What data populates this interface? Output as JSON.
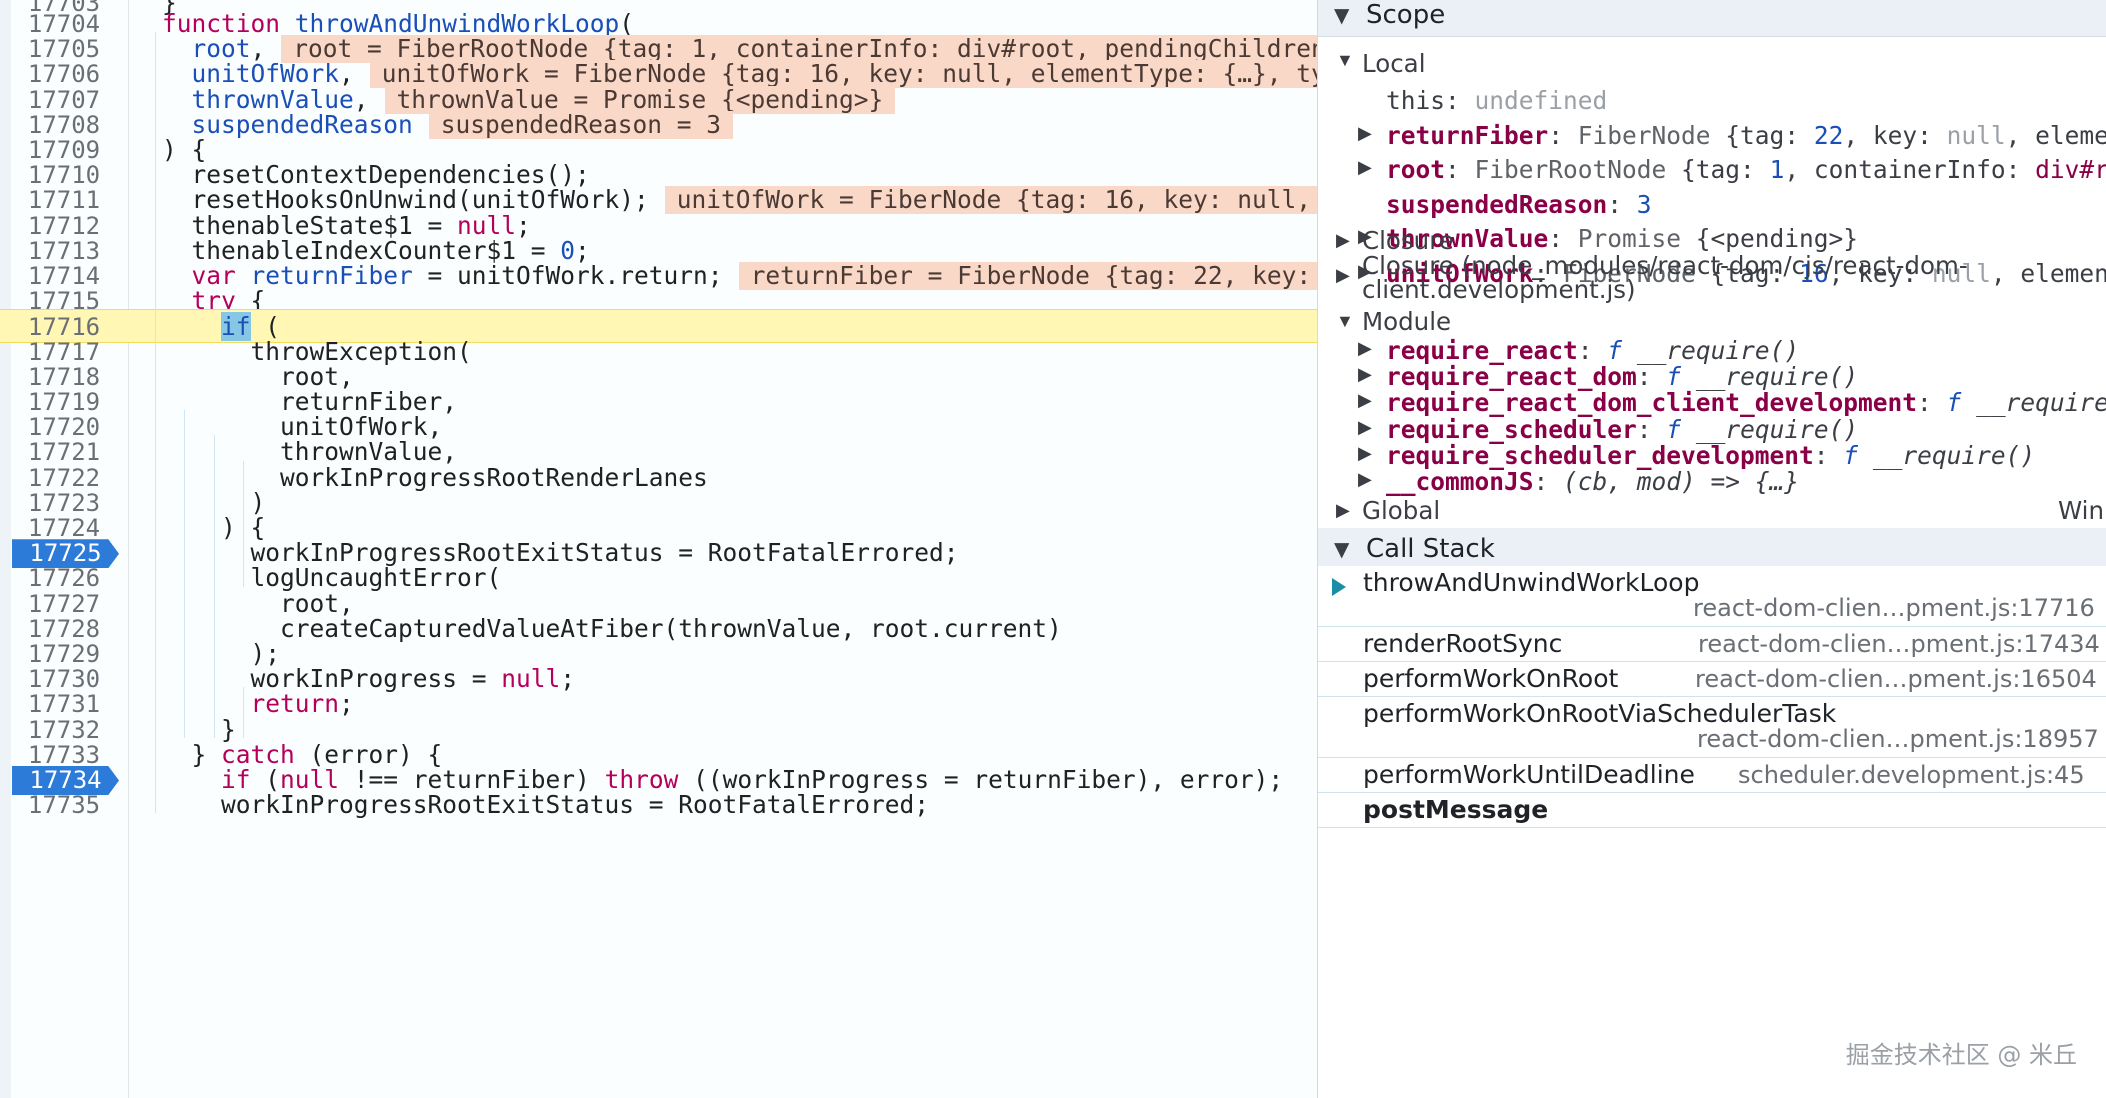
{
  "editor": {
    "lines": [
      {
        "no": "17704",
        "html": "<span class=\"kw\">function</span> <span class=\"fn\">throwAndUnwindWorkLoop</span>(",
        "indent": 0,
        "inline": ""
      },
      {
        "no": "17705",
        "html": "<span class=\"vr\">root</span>,",
        "indent": 1,
        "inline": "root = FiberRootNode {tag: 1, containerInfo: div#root, pendingChildren"
      },
      {
        "no": "17706",
        "html": "<span class=\"vr\">unitOfWork</span>,",
        "indent": 1,
        "inline": "unitOfWork = FiberNode {tag: 16, key: null, elementType: {…}, ty"
      },
      {
        "no": "17707",
        "html": "<span class=\"vr\">thrownValue</span>,",
        "indent": 1,
        "inline": "thrownValue = Promise {<pending>}"
      },
      {
        "no": "17708",
        "html": "<span class=\"vr\">suspendedReason</span>",
        "indent": 1,
        "inline": "suspendedReason = 3"
      },
      {
        "no": "17709",
        "html": ") {",
        "indent": 0,
        "inline": ""
      },
      {
        "no": "17710",
        "html": "resetContextDependencies();",
        "indent": 1,
        "inline": ""
      },
      {
        "no": "17711",
        "html": "resetHooksOnUnwind(unitOfWork);",
        "indent": 1,
        "inline": "unitOfWork = FiberNode {tag: 16, key: null,"
      },
      {
        "no": "17712",
        "html": "thenableState$1 = <span class=\"nl\">null</span>;",
        "indent": 1,
        "inline": ""
      },
      {
        "no": "17713",
        "html": "thenableIndexCounter$1 = <span class=\"num\">0</span>;",
        "indent": 1,
        "inline": ""
      },
      {
        "no": "17714",
        "html": "<span class=\"kw\">var</span> <span class=\"vr\">returnFiber</span> = unitOfWork.return;",
        "indent": 1,
        "inline": "returnFiber = FiberNode {tag: 22, key:"
      },
      {
        "no": "17715",
        "html": "<span class=\"kw\">try</span> {",
        "indent": 1,
        "inline": ""
      },
      {
        "no": "17716",
        "html": "<span class=\"kw hl-if\">if</span> (",
        "indent": 2,
        "inline": "",
        "paused": true
      },
      {
        "no": "17717",
        "html": "throwException(",
        "indent": 3,
        "inline": ""
      },
      {
        "no": "17718",
        "html": "root,",
        "indent": 4,
        "inline": ""
      },
      {
        "no": "17719",
        "html": "returnFiber,",
        "indent": 4,
        "inline": ""
      },
      {
        "no": "17720",
        "html": "unitOfWork,",
        "indent": 4,
        "inline": ""
      },
      {
        "no": "17721",
        "html": "thrownValue,",
        "indent": 4,
        "inline": ""
      },
      {
        "no": "17722",
        "html": "workInProgressRootRenderLanes",
        "indent": 4,
        "inline": ""
      },
      {
        "no": "17723",
        "html": ")",
        "indent": 3,
        "inline": ""
      },
      {
        "no": "17724",
        "html": ") {",
        "indent": 2,
        "inline": ""
      },
      {
        "no": "17725",
        "html": "workInProgressRootExitStatus = RootFatalErrored;",
        "indent": 3,
        "inline": "",
        "bp": true
      },
      {
        "no": "17726",
        "html": "logUncaughtError(",
        "indent": 3,
        "inline": ""
      },
      {
        "no": "17727",
        "html": "root,",
        "indent": 4,
        "inline": ""
      },
      {
        "no": "17728",
        "html": "createCapturedValueAtFiber(thrownValue, root.current)",
        "indent": 4,
        "inline": ""
      },
      {
        "no": "17729",
        "html": ");",
        "indent": 3,
        "inline": ""
      },
      {
        "no": "17730",
        "html": "workInProgress = <span class=\"nl\">null</span>;",
        "indent": 3,
        "inline": ""
      },
      {
        "no": "17731",
        "html": "<span class=\"kw\">return</span>;",
        "indent": 3,
        "inline": ""
      },
      {
        "no": "17732",
        "html": "}",
        "indent": 2,
        "inline": ""
      },
      {
        "no": "17733",
        "html": "} <span class=\"kw\">catch</span> (error) {",
        "indent": 1,
        "inline": ""
      },
      {
        "no": "17734",
        "html": "<span class=\"kw\">if</span> (<span class=\"nl\">null</span> !== returnFiber) <span class=\"kw\">throw</span> ((workInProgress = returnFiber), error);",
        "indent": 2,
        "inline": "",
        "bp": true
      },
      {
        "no": "17735",
        "html": "workInProgressRootExitStatus = RootFatalErrored;",
        "indent": 2,
        "inline": ""
      }
    ]
  },
  "scope": {
    "title": "Scope",
    "local_label": "Local",
    "rows": [
      {
        "arrow": false,
        "indent": 68,
        "html": "this: <span class=\"pg\">undefined</span>"
      },
      {
        "arrow": true,
        "indent": 68,
        "html": "<span class=\"pk\">returnFiber</span>: <span class=\"pv\">FiberNode</span> {tag: <span class=\"pn\">22</span>, key: <span class=\"pg\">null</span>, elemen"
      },
      {
        "arrow": true,
        "indent": 68,
        "html": "<span class=\"pk\">root</span>: <span class=\"pv\">FiberRootNode</span> {tag: <span class=\"pn\">1</span>, containerInfo: <span class=\"pp\">div#ro</span>"
      },
      {
        "arrow": false,
        "indent": 68,
        "html": "<span class=\"pk\">suspendedReason</span>: <span class=\"pn\">3</span>"
      },
      {
        "arrow": true,
        "indent": 68,
        "html": "<span class=\"pk\">thrownValue</span>: <span class=\"pv\">Promise</span> {&lt;pending&gt;}"
      },
      {
        "arrow": true,
        "indent": 68,
        "html": "<span class=\"pk\">unitOfWork</span>: <span class=\"pv\">FiberNode</span> {tag: <span class=\"pn\">16</span>, key: <span class=\"pg\">null</span>, element"
      }
    ],
    "closure1": "Closure",
    "closure2_line1": "Closure (node_modules/react-dom/cjs/react-dom-",
    "closure2_line2": "client.development.js)",
    "module_label": "Module",
    "module_rows": [
      {
        "html": "<span class=\"pk\">require_react</span>: <span class=\"fi\">f</span> <span class=\"it\">__require()</span>"
      },
      {
        "html": "<span class=\"pk\">require_react_dom</span>: <span class=\"fi\">f</span> <span class=\"it\">__require()</span>"
      },
      {
        "html": "<span class=\"pk\">require_react_dom_client_development</span>: <span class=\"fi\">f</span> <span class=\"it\">__require(</span>"
      },
      {
        "html": "<span class=\"pk\">require_scheduler</span>: <span class=\"fi\">f</span> <span class=\"it\">__require()</span>"
      },
      {
        "html": "<span class=\"pk\">require_scheduler_development</span>: <span class=\"fi\">f</span> <span class=\"it\">__require()</span>"
      },
      {
        "html": "<span class=\"pk\">__commonJS</span>: <span class=\"it\">(cb, mod) =&gt; {…}</span>"
      }
    ],
    "global_label": "Global",
    "global_value": "Win"
  },
  "callstack": {
    "title": "Call Stack",
    "frames": [
      {
        "name": "throwAndUnwindWorkLoop",
        "loc": "react-dom-clien…pment.js:17716",
        "current": true
      },
      {
        "name": "renderRootSync",
        "loc": "react-dom-clien…pment.js:17434"
      },
      {
        "name": "performWorkOnRoot",
        "loc": "react-dom-clien…pment.js:16504"
      },
      {
        "name": "performWorkOnRootViaSchedulerTask",
        "loc": "react-dom-clien…pment.js:18957"
      },
      {
        "name": "performWorkUntilDeadline",
        "loc": "scheduler.development.js:45"
      },
      {
        "name": "postMessage",
        "loc": ""
      }
    ]
  },
  "watermark": "掘金技术社区 @ 米丘"
}
